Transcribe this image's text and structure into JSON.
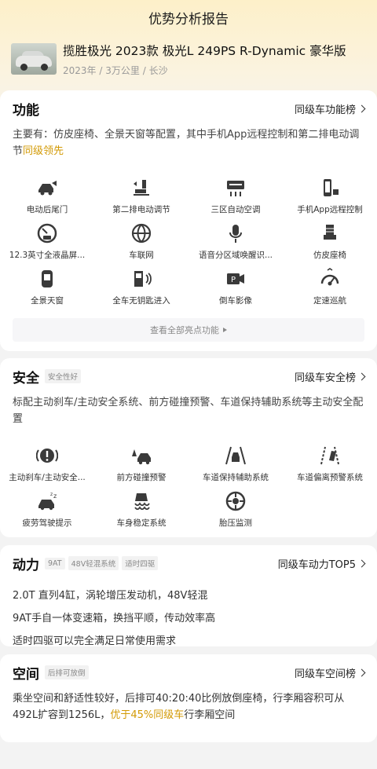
{
  "header": {
    "title": "优势分析报告"
  },
  "car": {
    "name": "揽胜极光 2023款 极光L 249PS R-Dynamic 豪华版",
    "year": "2023年",
    "mileage": "3万公里",
    "city": "长沙",
    "sep": "/"
  },
  "function": {
    "title": "功能",
    "rank_label": "同级车功能榜",
    "summary": "主要有：仿皮座椅、全景天窗等配置，其中手机App远程控制和第二排电动调节",
    "summary_highlight": "同级领先",
    "features": [
      {
        "label": "电动后尾门",
        "icon": "tailgate-icon"
      },
      {
        "label": "第二排电动调节",
        "icon": "seat-adjust-icon"
      },
      {
        "label": "三区自动空调",
        "icon": "air-conditioner-icon"
      },
      {
        "label": "手机App远程控制",
        "icon": "phone-remote-icon"
      },
      {
        "label": "12.3英寸全液晶屏...",
        "icon": "lcd-gauge-icon"
      },
      {
        "label": "车联网",
        "icon": "globe-icon"
      },
      {
        "label": "语音分区域唤醒识...",
        "icon": "microphone-icon"
      },
      {
        "label": "仿皮座椅",
        "icon": "seat-icon"
      },
      {
        "label": "全景天窗",
        "icon": "sunroof-icon"
      },
      {
        "label": "全车无钥匙进入",
        "icon": "keyless-door-icon"
      },
      {
        "label": "倒车影像",
        "icon": "reverse-camera-icon"
      },
      {
        "label": "定速巡航",
        "icon": "cruise-control-icon"
      }
    ],
    "view_all": "查看全部亮点功能"
  },
  "safety": {
    "title": "安全",
    "tag": "安全性好",
    "rank_label": "同级车安全榜",
    "summary": "标配主动刹车/主动安全系统、前方碰撞预警、车道保持辅助系统等主动安全配置",
    "features": [
      {
        "label": "主动刹车/主动安全...",
        "icon": "brake-warning-icon"
      },
      {
        "label": "前方碰撞预警",
        "icon": "collision-warning-icon"
      },
      {
        "label": "车道保持辅助系统",
        "icon": "lane-keep-icon"
      },
      {
        "label": "车道偏离预警系统",
        "icon": "lane-departure-icon"
      },
      {
        "label": "疲劳驾驶提示",
        "icon": "fatigue-icon"
      },
      {
        "label": "车身稳定系统",
        "icon": "stability-icon"
      },
      {
        "label": "胎压监测",
        "icon": "tire-pressure-icon"
      }
    ]
  },
  "power": {
    "title": "动力",
    "tags": [
      "9AT",
      "48V轻混系统",
      "适时四驱"
    ],
    "rank_label": "同级车动力TOP5",
    "lines": [
      "2.0T 直列4缸，涡轮增压发动机，48V轻混",
      "9AT手自一体变速箱，换挡平顺，传动效率高",
      "适时四驱可以完全满足日常使用需求"
    ]
  },
  "space": {
    "title": "空间",
    "tag": "后排可放倒",
    "rank_label": "同级车空间榜",
    "summary_a": "乘坐空间和舒适性较好，后排可40:20:40比例放倒座椅，行李厢容积可从492L扩容到1256L，",
    "summary_highlight": "优于45%同级车",
    "summary_b": "行李厢空间"
  },
  "colors": {
    "accent": "#d39a05",
    "icon": "#3a3a3a"
  }
}
